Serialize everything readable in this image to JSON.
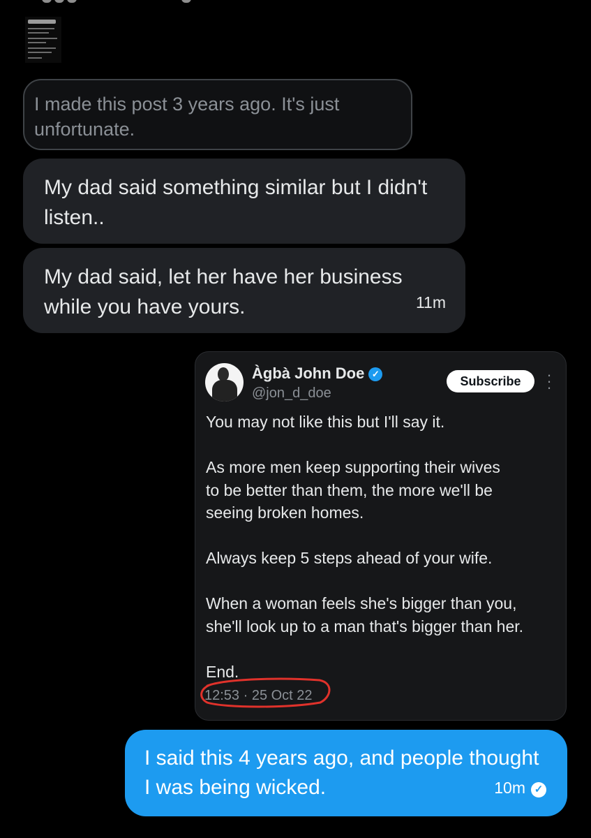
{
  "chat": {
    "quoted_reply": {
      "text": "I made this post 3 years ago. It's just unfortunate."
    },
    "incoming": [
      {
        "text": "My dad said something similar but I didn't listen..",
        "time": ""
      },
      {
        "text": "My dad said, let her have her business while you have yours.",
        "time": "11m"
      }
    ],
    "shared_post": {
      "author_name": "Àgbà John Doe",
      "handle": "@jon_d_doe",
      "subscribe_label": "Subscribe",
      "more_icon": "more-vertical-icon",
      "verified_icon": "verified-badge-icon",
      "paragraphs": [
        "You may not like this but I'll say it.",
        "As more men keep supporting their wives\nto be better than them, the more we'll be\nseeing broken homes.",
        "Always keep 5 steps ahead of your wife.",
        "When a woman feels she's bigger than you,\nshe'll look up to a man that's bigger than her.",
        "End."
      ],
      "timestamp": "12:53 · 25 Oct 22"
    },
    "outgoing": {
      "text": "I said this 4 years ago, and people thought I was being wicked.",
      "time": "10m",
      "status_icon": "sent-check-icon"
    }
  },
  "colors": {
    "background": "#000000",
    "incoming_bubble": "#202226",
    "outgoing_bubble": "#1d9bf0",
    "annotation_red": "#e0322b"
  }
}
